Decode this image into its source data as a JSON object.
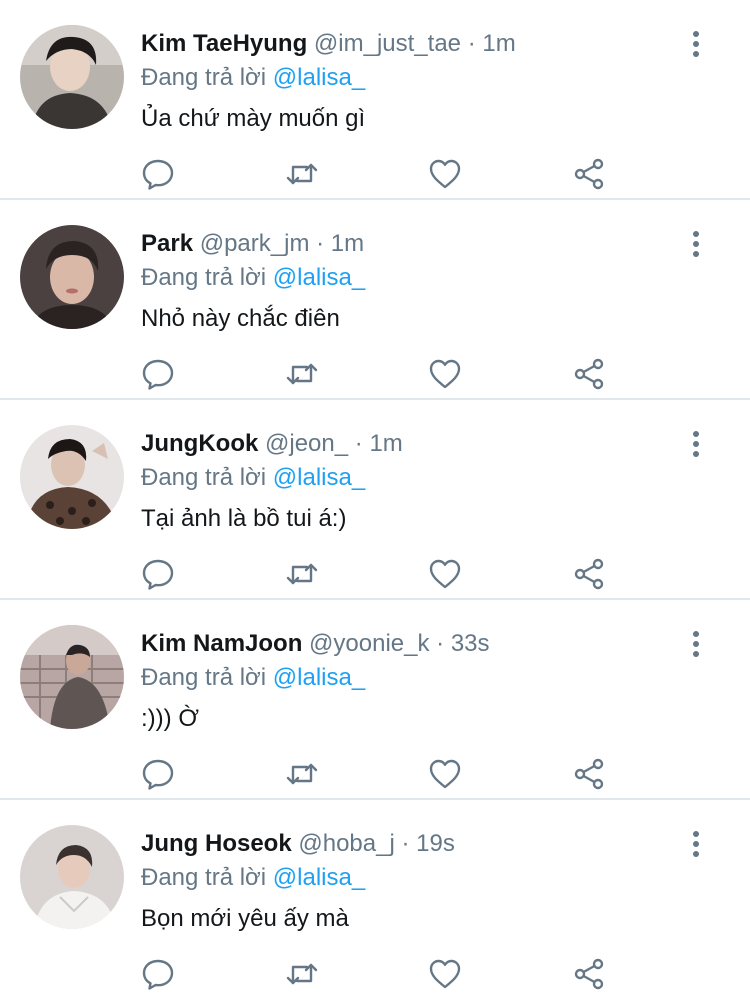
{
  "tweets": [
    {
      "name": "Kim TaeHyung",
      "handle": "@im_just_tae",
      "separator": "·",
      "time": "1m",
      "reply_prefix": "Đang trả lời",
      "mention": "@lalisa_",
      "text": "Ủa chứ mày muốn gì",
      "avatar_colors": [
        "#b9b3ad",
        "#3a3634",
        "#1e1b1a"
      ]
    },
    {
      "name": "Park",
      "handle": "@park_jm",
      "separator": "·",
      "time": "1m",
      "reply_prefix": "Đang trả lời",
      "mention": "@lalisa_",
      "text": "Nhỏ này chắc điên",
      "avatar_colors": [
        "#4a4140",
        "#d9b8a8",
        "#2a2322"
      ]
    },
    {
      "name": "JungKook",
      "handle": "@jeon_",
      "separator": "·",
      "time": "1m",
      "reply_prefix": "Đang trả lời",
      "mention": "@lalisa_",
      "text": "Tại ảnh là bồ tui á:)",
      "avatar_colors": [
        "#e7e4e3",
        "#5a4236",
        "#1c1715"
      ]
    },
    {
      "name": "Kim NamJoon",
      "handle": "@yoonie_k",
      "separator": "·",
      "time": "33s",
      "reply_prefix": "Đang trả lời",
      "mention": "@lalisa_",
      "text": ":))) Ờ",
      "avatar_colors": [
        "#b7a6a3",
        "#5f5653",
        "#2a2524"
      ]
    },
    {
      "name": "Jung Hoseok",
      "handle": "@hoba_j",
      "separator": "·",
      "time": "19s",
      "reply_prefix": "Đang trả lời",
      "mention": "@lalisa_",
      "text": "Bọn mới yêu ấy mà",
      "avatar_colors": [
        "#d9d4d1",
        "#f4f2f0",
        "#3b3230"
      ]
    }
  ],
  "icons": {
    "reply": "reply-icon",
    "retweet": "retweet-icon",
    "like": "like-icon",
    "share": "share-icon",
    "more": "more-options-icon"
  },
  "colors": {
    "text": "#14171a",
    "secondary": "#657786",
    "mention": "#1da1f2",
    "divider": "#e1e8ed"
  }
}
